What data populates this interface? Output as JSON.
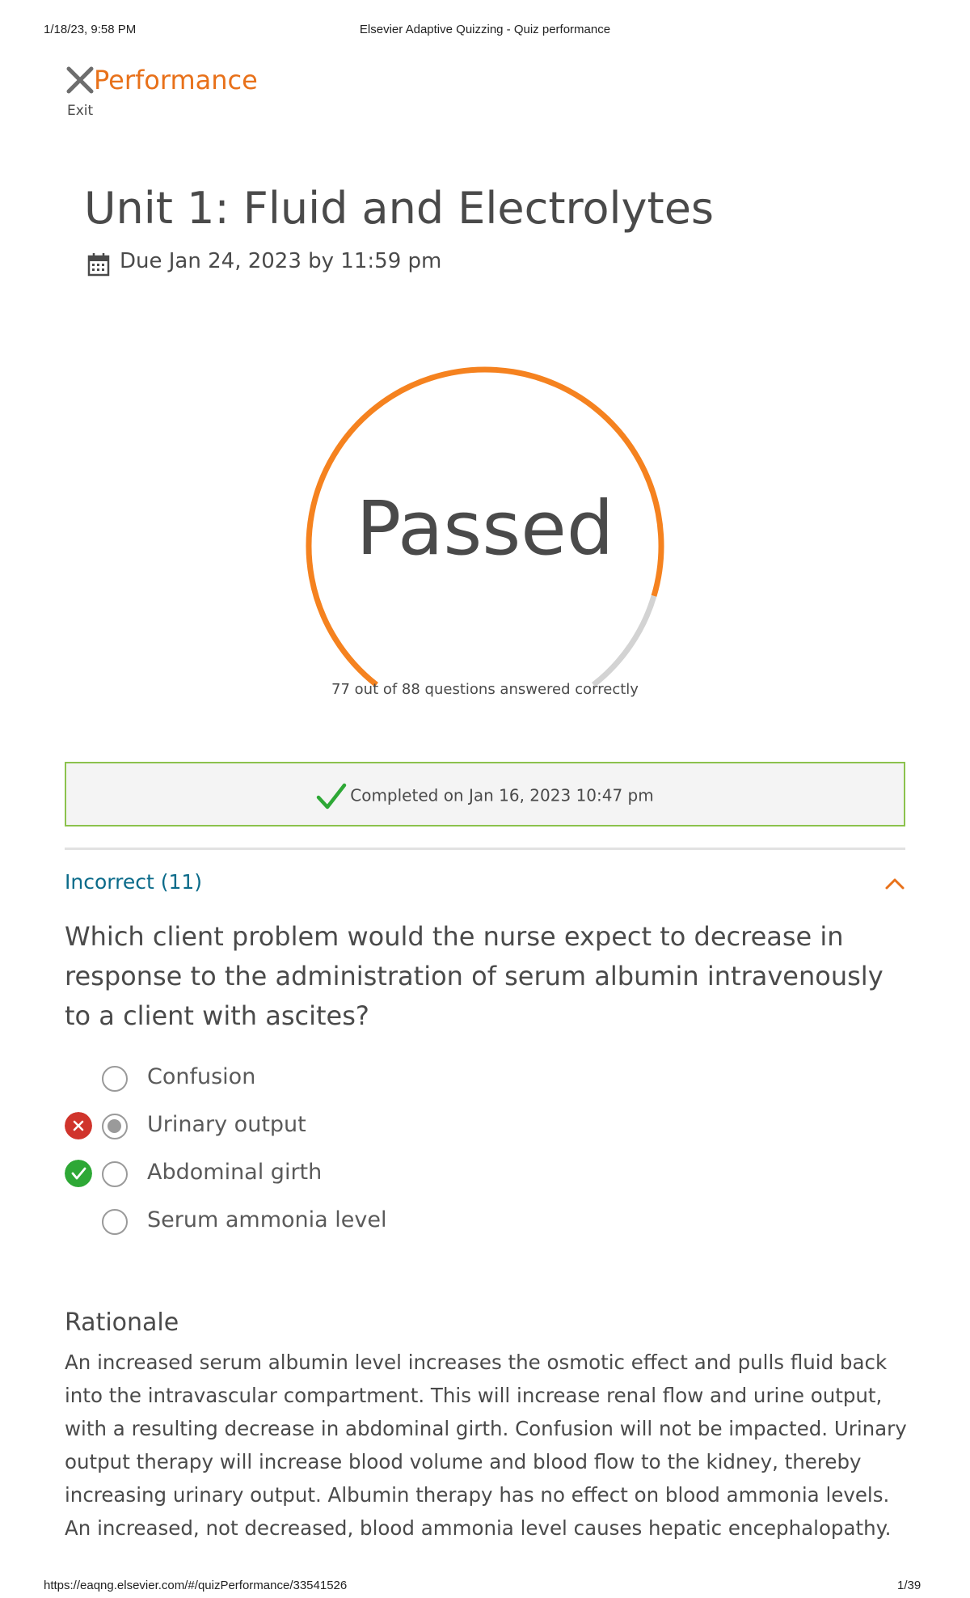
{
  "print_header": {
    "datetime": "1/18/23, 9:58 PM",
    "page_title": "Elsevier Adaptive Quizzing - Quiz performance"
  },
  "print_footer": {
    "url": "https://eaqng.elsevier.com/#/quizPerformance/33541526",
    "page": "1/39"
  },
  "header": {
    "title": "Performance",
    "exit_label": "Exit",
    "exit_icon": "close-icon"
  },
  "quiz": {
    "title": "Unit 1: Fluid and Electrolytes",
    "due": "Due Jan 24, 2023 by 11:59 pm",
    "due_icon": "calendar-icon"
  },
  "result": {
    "status": "Passed",
    "summary": "77 out of 88 questions answered correctly",
    "correct": 77,
    "total": 88,
    "accent_color": "#f5821f",
    "track_color": "#d3d3d3"
  },
  "completion": {
    "text": "Completed on Jan 16, 2023 10:47 pm",
    "icon": "checkmark-icon",
    "border_color": "#8cc24d"
  },
  "section": {
    "label": "Incorrect (11)",
    "toggle_icon": "chevron-up-icon"
  },
  "question": {
    "text": "Which client problem would the nurse expect to decrease in response to the administration of serum albumin intravenously to a client with ascites?",
    "options": [
      {
        "label": "Confusion",
        "selected": false,
        "mark": ""
      },
      {
        "label": "Urinary output",
        "selected": true,
        "mark": "incorrect"
      },
      {
        "label": "Abdominal girth",
        "selected": false,
        "mark": "correct"
      },
      {
        "label": "Serum ammonia level",
        "selected": false,
        "mark": ""
      }
    ]
  },
  "rationale": {
    "title": "Rationale",
    "text": "An increased serum albumin level increases the osmotic effect and pulls fluid back into the intravascular compartment. This will increase renal flow and urine output, with a resulting decrease in abdominal girth. Confusion will not be impacted. Urinary output therapy will increase blood volume and blood flow to the kidney, thereby increasing urinary output. Albumin therapy has no effect on blood ammonia levels. An increased, not decreased, blood ammonia level causes hepatic encephalopathy."
  }
}
